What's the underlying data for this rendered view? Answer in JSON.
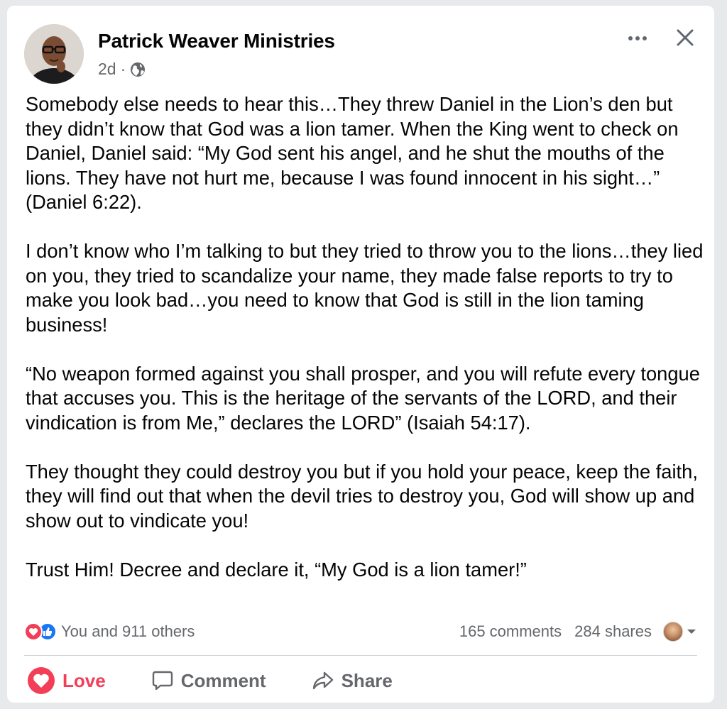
{
  "post": {
    "author": "Patrick Weaver Ministries",
    "time": "2d",
    "dot": "·",
    "audience_icon": "globe-icon",
    "paragraphs": [
      "Somebody else needs to hear this…They threw Daniel in the Lion’s den but they didn’t know that God was a lion tamer. When the King went to check on Daniel, Daniel said: “My God sent his angel, and he shut the mouths of the lions. They have not hurt me, because I was found innocent in his sight…” (Daniel 6:22).",
      "I don’t know who I’m talking to but they tried to throw you to the lions…they lied on you, they tried to scandalize your name, they made false reports to try to make you look bad…you need to know that God is still in the lion taming business!",
      "“No weapon formed against you shall prosper, and you will refute every tongue that accuses you. This is the heritage of the servants of the LORD, and their vindication is from Me,” declares the LORD” (Isaiah 54:17).",
      "They thought they could destroy you but if you hold your peace, keep the faith, they will find out that when the devil tries to destroy you, God will show up and show out to vindicate you!",
      "Trust Him! Decree and declare it, “My God is a lion tamer!”"
    ]
  },
  "stats": {
    "reactions_text": "You and 911 others",
    "comments": "165 comments",
    "shares": "284 shares"
  },
  "actions": {
    "love": "Love",
    "comment": "Comment",
    "share": "Share"
  },
  "colors": {
    "love": "#f33e58",
    "like": "#1877f2",
    "secondary_text": "#65676b"
  }
}
